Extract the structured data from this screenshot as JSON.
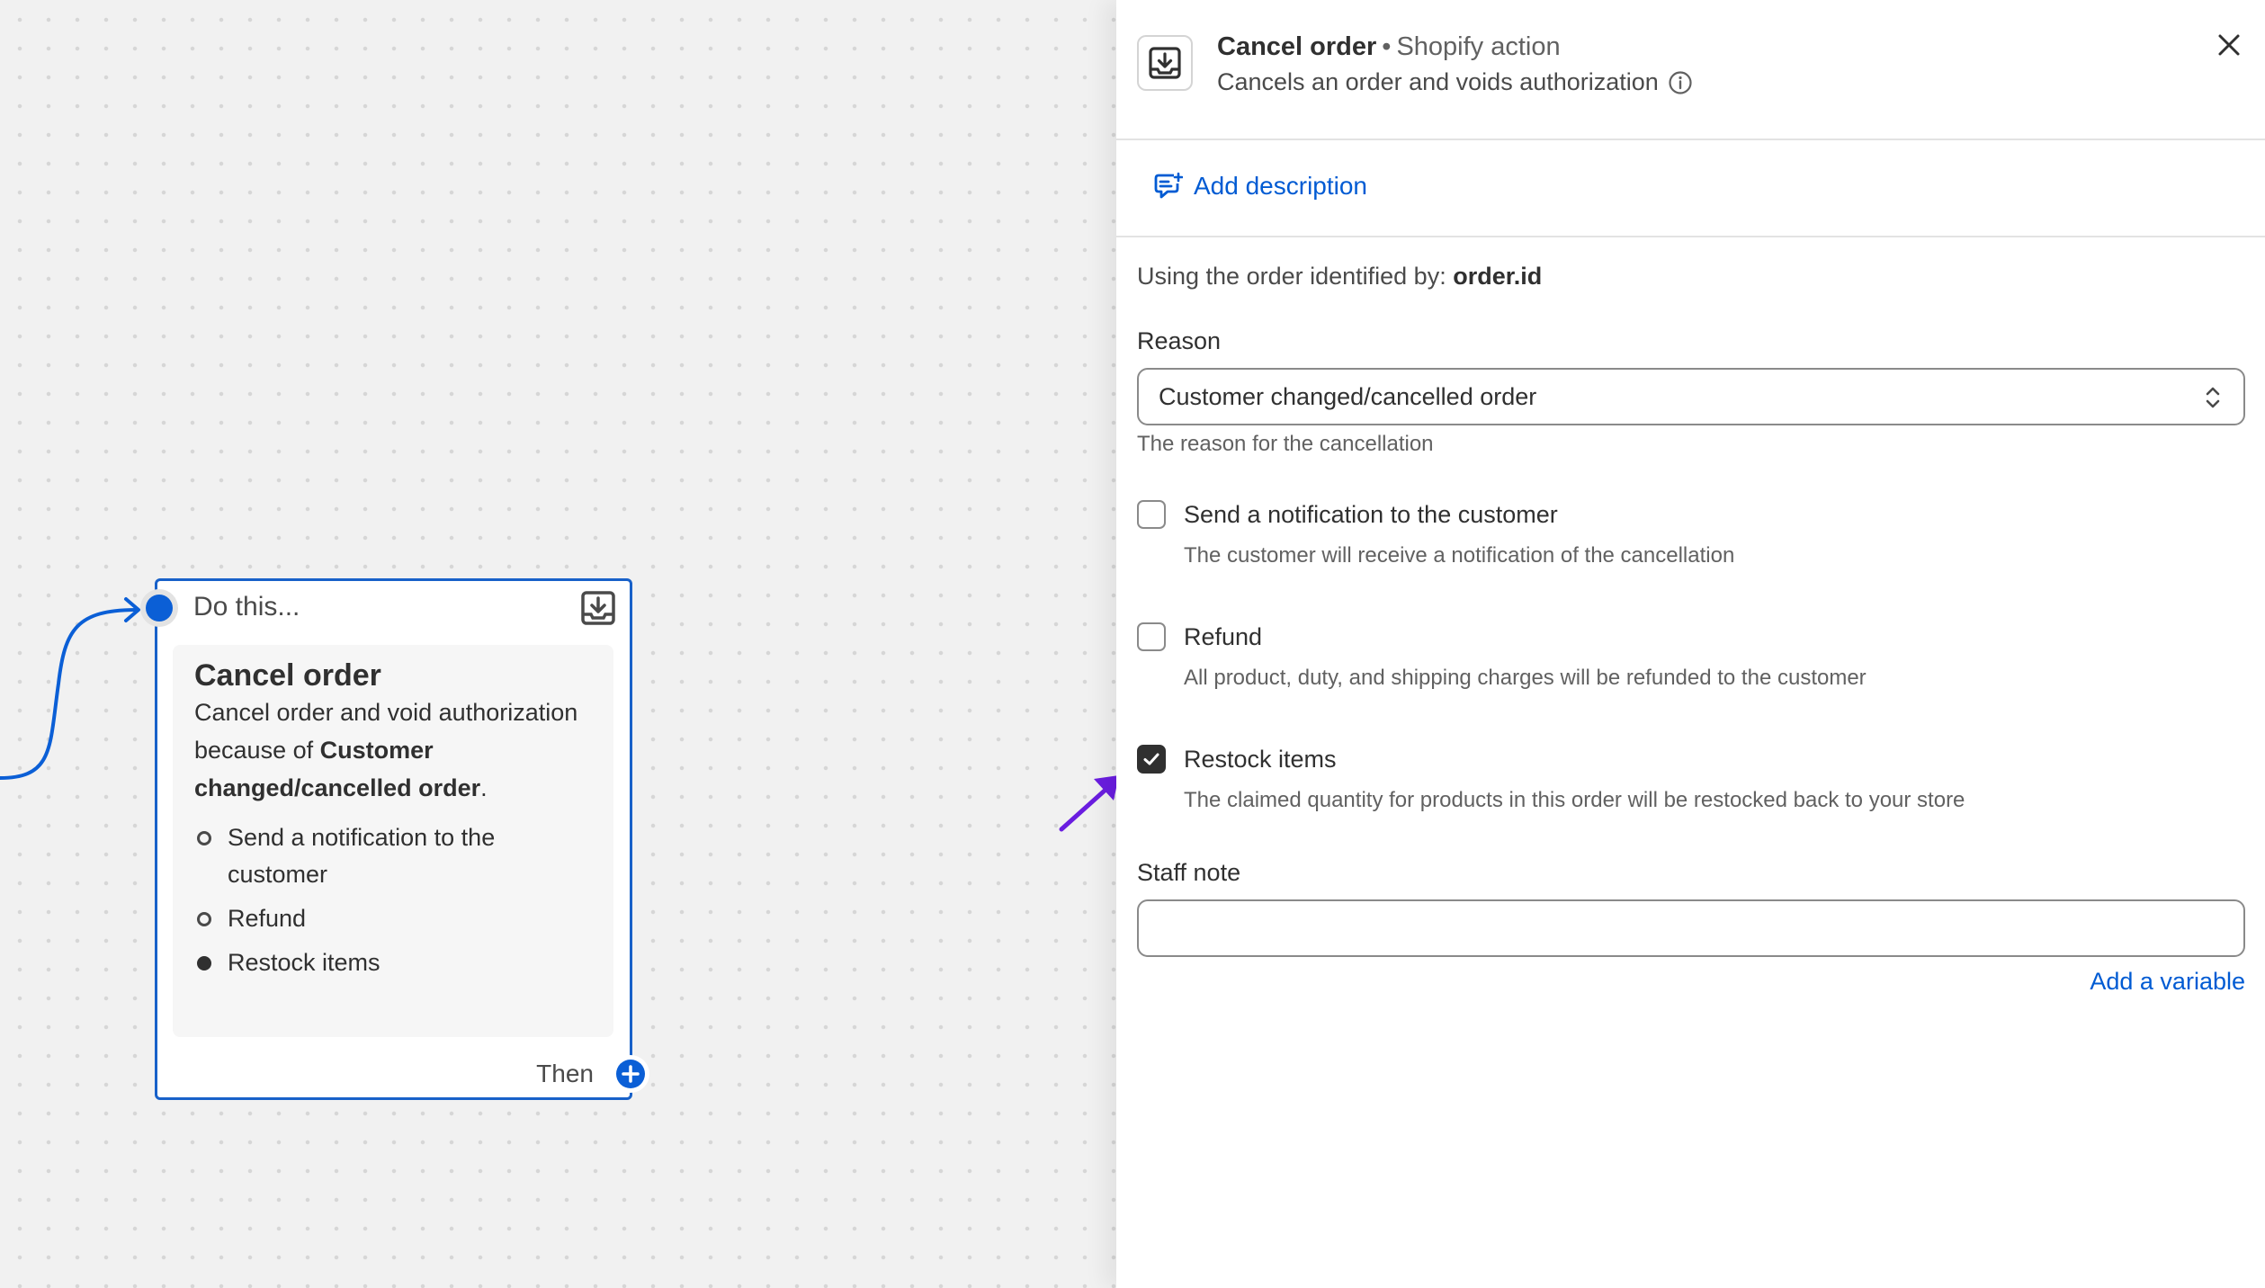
{
  "colors": {
    "accent": "#005bd3",
    "node_border": "#1861c9",
    "arrow": "#6a1de0"
  },
  "canvas": {
    "node": {
      "header": "Do this...",
      "title": "Cancel order",
      "desc_prefix": "Cancel order and void authorization because of ",
      "desc_reason": "Customer changed/cancelled order",
      "desc_suffix": ".",
      "options": [
        {
          "label": "Send a notification to the customer",
          "enabled": false
        },
        {
          "label": "Refund",
          "enabled": false
        },
        {
          "label": "Restock items",
          "enabled": true
        }
      ],
      "then_label": "Then",
      "icon": "download-box-icon"
    }
  },
  "panel": {
    "title": "Cancel order",
    "separator": "•",
    "type": "Shopify action",
    "subtitle": "Cancels an order and voids authorization",
    "add_description": "Add description",
    "identifier_prefix": "Using the order identified by: ",
    "identifier": "order.id",
    "reason": {
      "label": "Reason",
      "value": "Customer changed/cancelled order",
      "help": "The reason for the cancellation"
    },
    "checkboxes": [
      {
        "label": "Send a notification to the customer",
        "help": "The customer will receive a notification of the cancellation",
        "checked": false
      },
      {
        "label": "Refund",
        "help": "All product, duty, and shipping charges will be refunded to the customer",
        "checked": false
      },
      {
        "label": "Restock items",
        "help": "The claimed quantity for products in this order will be restocked back to your store",
        "checked": true
      }
    ],
    "staff_note": {
      "label": "Staff note",
      "value": ""
    },
    "add_variable": "Add a variable"
  }
}
